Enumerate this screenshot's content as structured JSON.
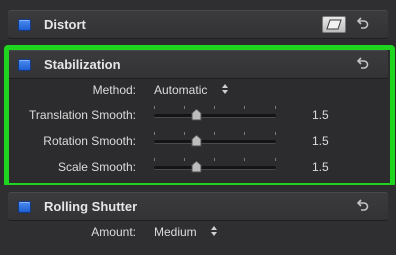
{
  "distort": {
    "title": "Distort"
  },
  "stabilization": {
    "title": "Stabilization",
    "method": {
      "label": "Method:",
      "value": "Automatic"
    },
    "translation_smooth": {
      "label": "Translation Smooth:",
      "value": "1.5"
    },
    "rotation_smooth": {
      "label": "Rotation Smooth:",
      "value": "1.5"
    },
    "scale_smooth": {
      "label": "Scale Smooth:",
      "value": "1.5"
    }
  },
  "rolling_shutter": {
    "title": "Rolling Shutter",
    "amount": {
      "label": "Amount:",
      "value": "Medium"
    }
  },
  "colors": {
    "highlight_border": "#1fd61f",
    "checkbox_blue": "#2f6fe0"
  },
  "icons": {
    "checkbox": "checkbox-icon",
    "reset": "reset-arrow-icon",
    "shape": "parallelogram-icon",
    "popup": "updown-arrows-icon",
    "slider_thumb": "slider-thumb-icon"
  }
}
